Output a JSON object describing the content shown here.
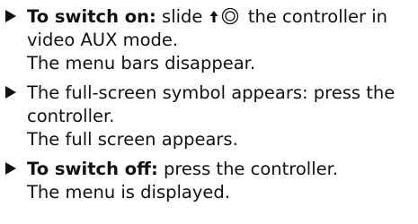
{
  "steps": [
    {
      "label": "To switch on:",
      "line1_before": " slide ",
      "line1_after": " the controller in",
      "line2": "video AUX mode.",
      "result": "The menu bars disappear."
    },
    {
      "line1": "The full-screen symbol appears: press the",
      "line2": "controller.",
      "result": "The full screen appears."
    },
    {
      "label": "To switch off:",
      "line1_rest": " press the controller.",
      "result": "The menu is displayed."
    }
  ],
  "icons": {
    "controller_slide": "controller-slide-up-icon",
    "bullet": "triangle-bullet-icon"
  }
}
